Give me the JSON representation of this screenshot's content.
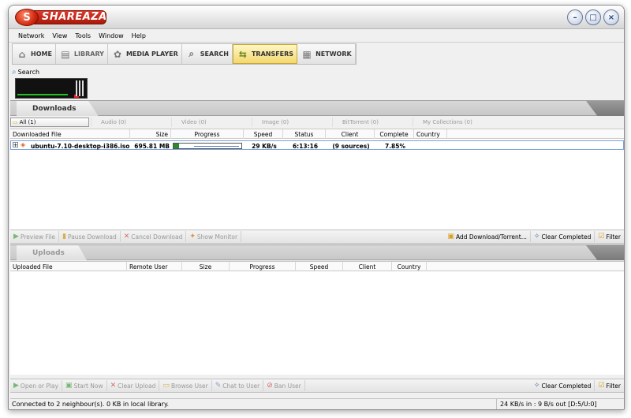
{
  "app": {
    "title": "SHAREAZA",
    "logo_letter": "S"
  },
  "window_controls": {
    "minimize": "–",
    "maximize": "□",
    "close": "×"
  },
  "menu": [
    "Network",
    "View",
    "Tools",
    "Window",
    "Help"
  ],
  "nav": [
    {
      "label": "HOME",
      "icon": "home-icon",
      "glyph": "⌂"
    },
    {
      "label": "LIBRARY",
      "icon": "library-icon",
      "glyph": "▤"
    },
    {
      "label": "MEDIA PLAYER",
      "icon": "media-player-icon",
      "glyph": "✿"
    },
    {
      "label": "SEARCH",
      "icon": "search-icon",
      "glyph": "⌕"
    },
    {
      "label": "TRANSFERS",
      "icon": "transfers-icon",
      "glyph": "⇆",
      "active": true
    },
    {
      "label": "NETWORK",
      "icon": "network-icon",
      "glyph": "▦"
    }
  ],
  "search_button": "Search",
  "downloads": {
    "title": "Downloads",
    "filters": [
      "All (1)",
      "Audio (0)",
      "Video (0)",
      "Image (0)",
      "BitTorrent (0)",
      "My Collections (0)"
    ],
    "columns": [
      "Downloaded File",
      "Size",
      "Progress",
      "Speed",
      "Status",
      "Client",
      "Complete",
      "Country"
    ],
    "rows": [
      {
        "file": "ubuntu-7.10-desktop-i386.iso",
        "size": "695.81 MB",
        "progress": 0.0785,
        "speed": "29 KB/s",
        "status": "6:13:16",
        "client": "(9 sources)",
        "complete": "7.85%",
        "country": ""
      }
    ],
    "actions_left": [
      "Preview File",
      "Pause Download",
      "Cancel Download",
      "Show Monitor"
    ],
    "actions_right": [
      "Add Download/Torrent...",
      "Clear Completed",
      "Filter"
    ]
  },
  "uploads": {
    "title": "Uploads",
    "columns": [
      "Uploaded File",
      "Remote User",
      "Size",
      "Progress",
      "Speed",
      "Client",
      "Country"
    ],
    "actions_left": [
      "Open or Play",
      "Start Now",
      "Clear Upload",
      "Browse User",
      "Chat to User",
      "Ban User"
    ],
    "actions_right": [
      "Clear Completed",
      "Filter"
    ]
  },
  "status": {
    "left": "Connected to 2 neighbour(s).  0 KB in local library.",
    "right": "24 KB/s in : 9 B/s out [D:5/U:0]"
  },
  "colors": {
    "brand": "#c8200e",
    "progress": "#2a8a2a",
    "active_tab": "#f3d870"
  }
}
